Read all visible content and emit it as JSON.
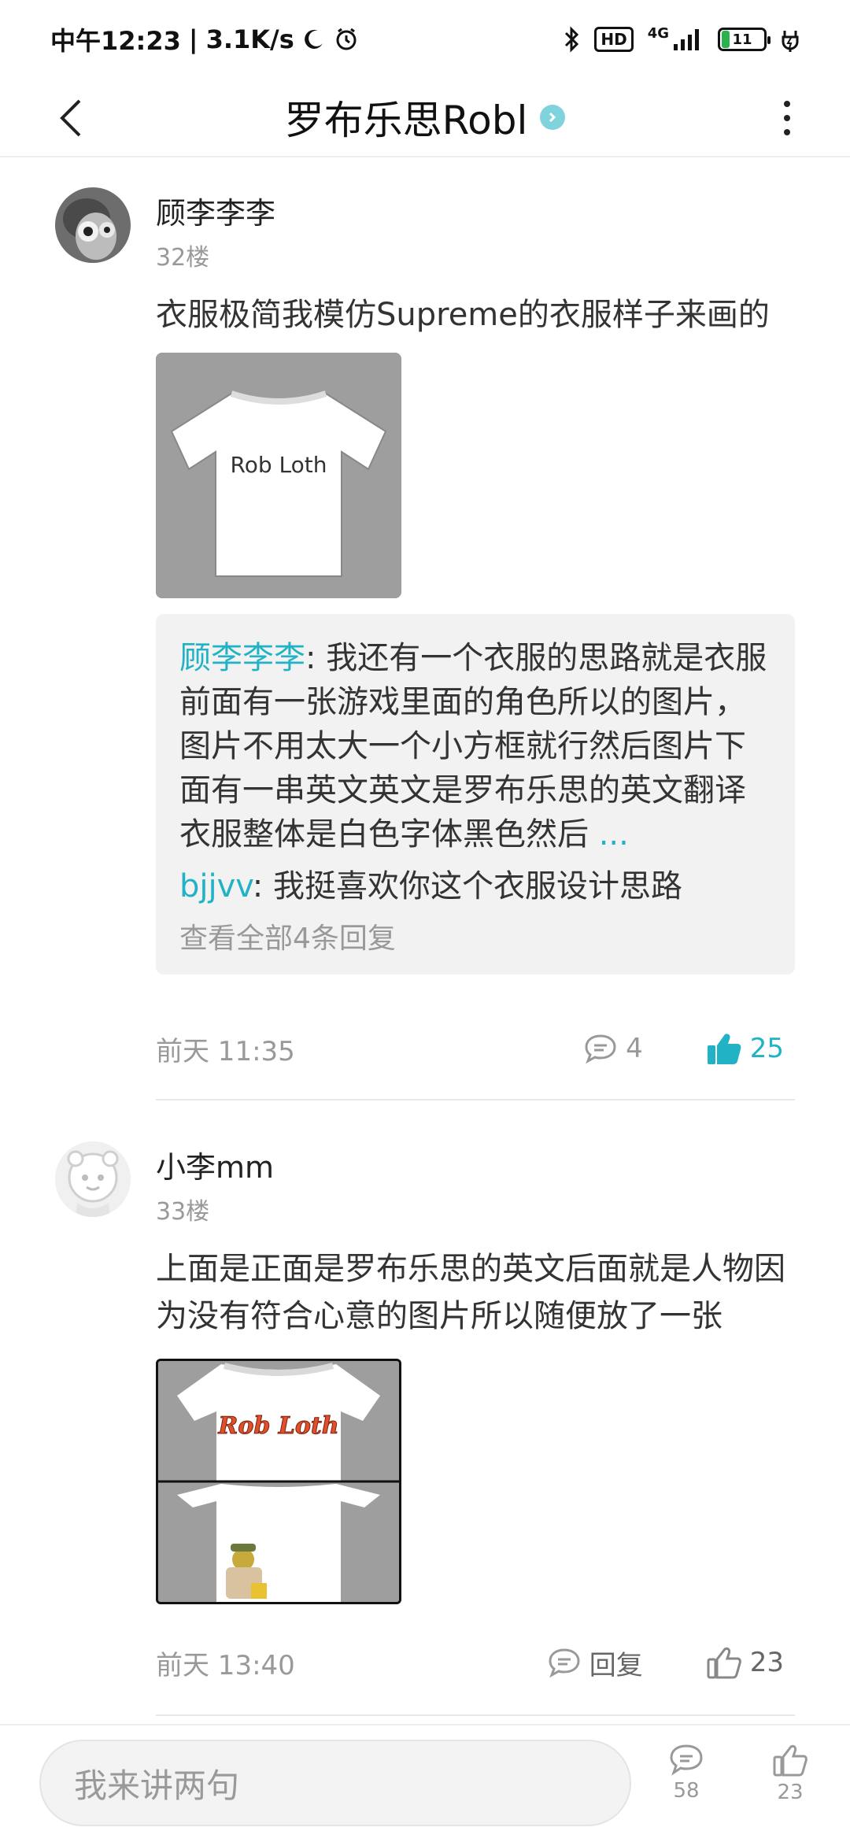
{
  "status_bar": {
    "time": "中午12:23",
    "speed": "3.1K/s",
    "hd": "HD",
    "network": "4G",
    "battery": "11"
  },
  "header": {
    "title": "罗布乐思Robl"
  },
  "posts": [
    {
      "username": "顾李李李",
      "floor": "32楼",
      "text": "衣服极简我模仿Supreme的衣服样子来画的",
      "image_text": "Rob Loth",
      "replies": [
        {
          "name": "顾李李李",
          "sep": ": ",
          "text": "我还有一个衣服的思路就是衣服前面有一张游戏里面的角色所以的图片，图片不用太大一个小方框就行然后图片下面有一串英文英文是罗布乐思的英文翻译衣服整体是白色字体黑色然后",
          "more": " ..."
        },
        {
          "name": "bjjvv",
          "sep": ": ",
          "text": "我挺喜欢你这个衣服设计思路",
          "more": ""
        }
      ],
      "view_all": "查看全部4条回复",
      "time": "前天 11:35",
      "comments": "4",
      "likes": "25"
    },
    {
      "username": "小李mm",
      "floor": "33楼",
      "text": "上面是正面是罗布乐思的英文后面就是人物因为没有符合心意的图片所以随便放了一张",
      "image_text": "Rob Loth",
      "time": "前天 13:40",
      "reply_label": "回复",
      "likes": "23"
    }
  ],
  "bottom_bar": {
    "placeholder": "我来讲两句",
    "comment_count": "58",
    "like_count": "23"
  },
  "colors": {
    "accent": "#21b3c5",
    "muted": "#999999"
  }
}
